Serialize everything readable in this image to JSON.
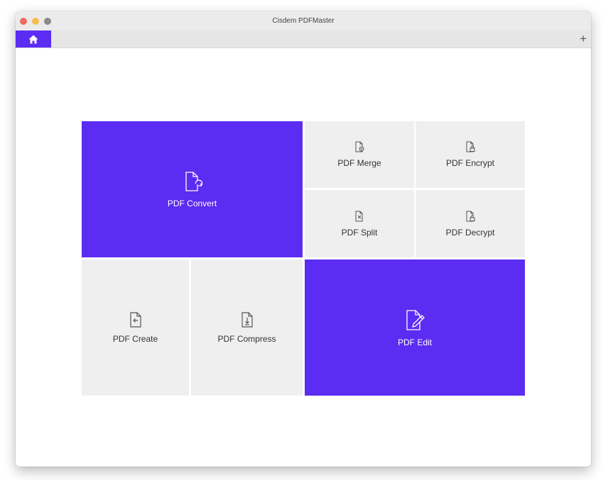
{
  "window": {
    "title": "Cisdem PDFMaster"
  },
  "tabbar": {
    "home_icon": "home-icon",
    "add_tab_label": "+"
  },
  "tiles": {
    "convert": {
      "label": "PDF Convert",
      "icon": "convert-icon"
    },
    "merge": {
      "label": "PDF Merge",
      "icon": "merge-icon"
    },
    "encrypt": {
      "label": "PDF Encrypt",
      "icon": "encrypt-icon"
    },
    "split": {
      "label": "PDF Split",
      "icon": "split-icon"
    },
    "decrypt": {
      "label": "PDF Decrypt",
      "icon": "decrypt-icon"
    },
    "create": {
      "label": "PDF Create",
      "icon": "create-icon"
    },
    "compress": {
      "label": "PDF Compress",
      "icon": "compress-icon"
    },
    "edit": {
      "label": "PDF Edit",
      "icon": "edit-icon"
    }
  },
  "colors": {
    "accent": "#5b2cf2",
    "tile_gray": "#efefef"
  }
}
